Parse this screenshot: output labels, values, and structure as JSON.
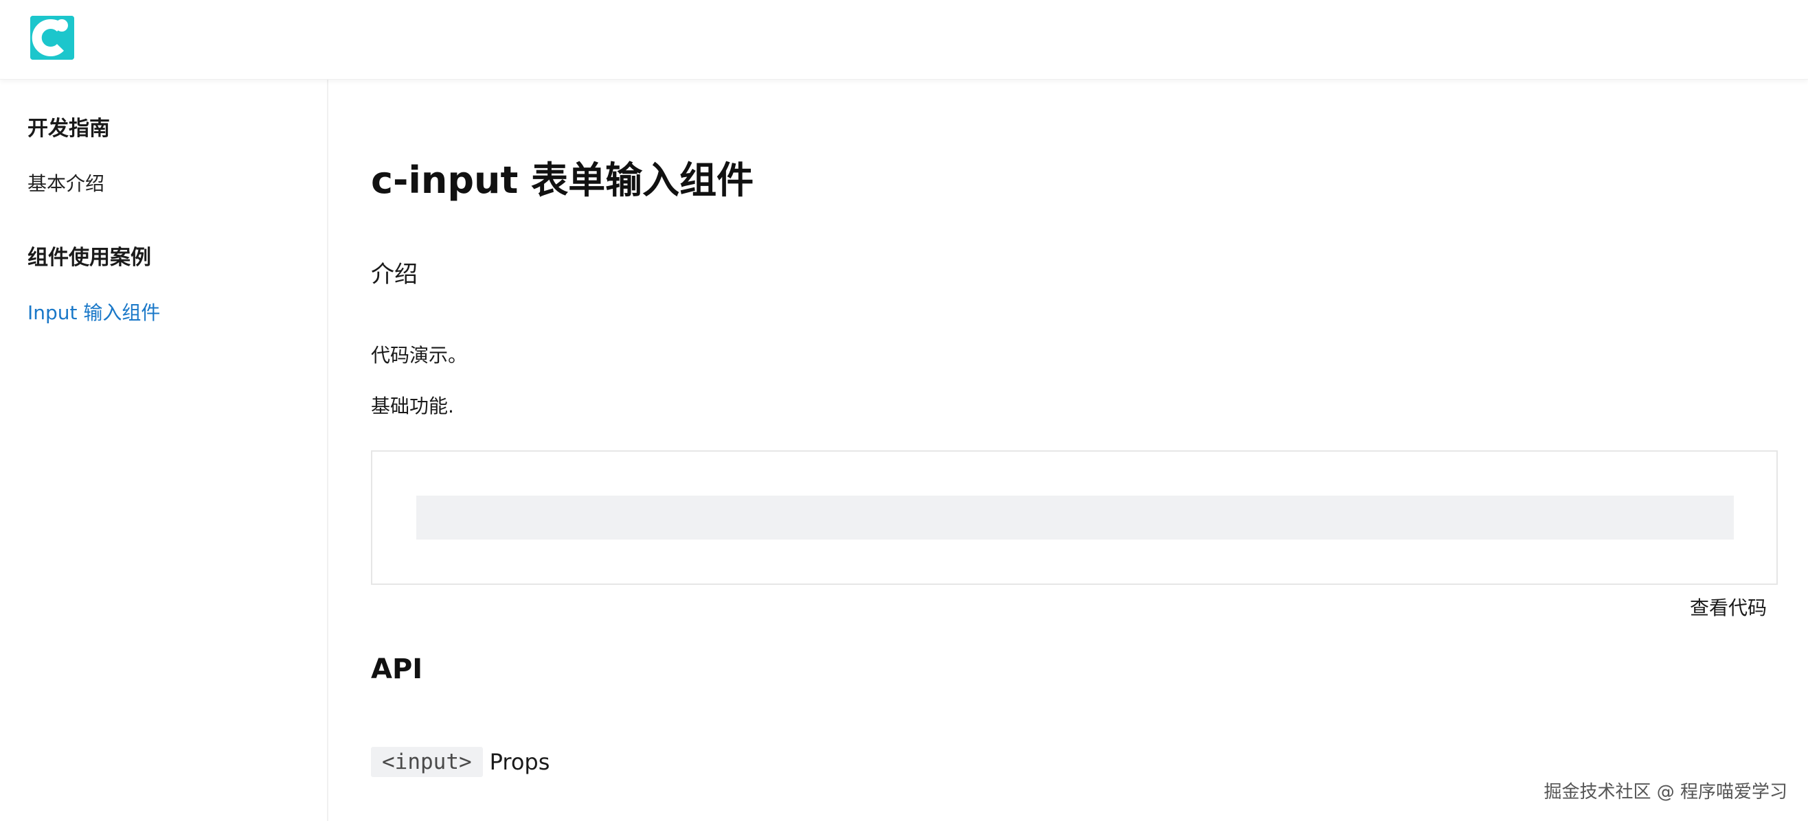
{
  "header": {
    "logo_icon": "c-letter-logo-icon",
    "brand_color": "#1cc6cc"
  },
  "sidebar": {
    "groups": [
      {
        "title": "开发指南",
        "items": [
          {
            "label": "基本介绍",
            "active": false
          }
        ]
      },
      {
        "title": "组件使用案例",
        "items": [
          {
            "label": "Input 输入组件",
            "active": true
          }
        ]
      }
    ],
    "active_color": "#1a78c8"
  },
  "main": {
    "title": "c-input 表单输入组件",
    "intro_heading": "介绍",
    "paragraphs": [
      "代码演示。",
      "基础功能."
    ],
    "demo": {
      "input_value": "",
      "input_placeholder": ""
    },
    "view_code_label": "查看代码",
    "api_heading": "API",
    "props_code": "<input>",
    "props_label": "Props"
  },
  "watermark": "掘金技术社区 @ 程序喵爱学习"
}
